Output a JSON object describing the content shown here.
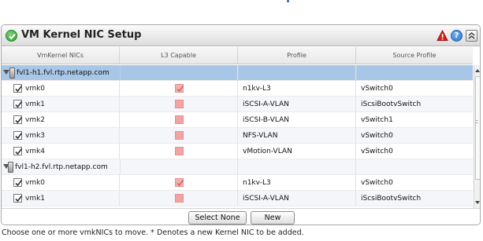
{
  "panel": {
    "title": "VM Kernel NIC Setup",
    "icons": [
      "success-check-icon",
      "warning-icon",
      "help-icon",
      "collapse-icon"
    ]
  },
  "columns": [
    "VmKernel NICs",
    "L3 Capable",
    "Profile",
    "Source Profile"
  ],
  "groups": [
    {
      "host": "fvl1-h1.fvl.rtp.netapp.com",
      "selected": true,
      "nics": [
        {
          "name": "vmk0",
          "checked": true,
          "l3": true,
          "profile": "n1kv-L3",
          "source": "vSwitch0"
        },
        {
          "name": "vmk1",
          "checked": true,
          "l3": false,
          "profile": "iSCSI-A-VLAN",
          "source": "iScsiBootvSwitch"
        },
        {
          "name": "vmk2",
          "checked": true,
          "l3": false,
          "profile": "iSCSI-B-VLAN",
          "source": "vSwitch1"
        },
        {
          "name": "vmk3",
          "checked": true,
          "l3": false,
          "profile": "NFS-VLAN",
          "source": "vSwitch0"
        },
        {
          "name": "vmk4",
          "checked": true,
          "l3": false,
          "profile": "vMotion-VLAN",
          "source": "vSwitch0"
        }
      ]
    },
    {
      "host": "fvl1-h2.fvl.rtp.netapp.com",
      "selected": false,
      "nics": [
        {
          "name": "vmk0",
          "checked": true,
          "l3": true,
          "profile": "n1kv-L3",
          "source": "vSwitch0"
        },
        {
          "name": "vmk1",
          "checked": true,
          "l3": false,
          "profile": "iSCSI-A-VLAN",
          "source": "iScsiBootvSwitch"
        }
      ]
    }
  ],
  "buttons": {
    "select_none": "Select None",
    "new": "New"
  },
  "hint": "Choose one or more vmkNICs to move. * Denotes a new Kernel NIC to be added.",
  "colors": {
    "selected_row": "#a8c6e6",
    "l3_box": "#f2a3a3",
    "success": "#2e9a2a"
  }
}
